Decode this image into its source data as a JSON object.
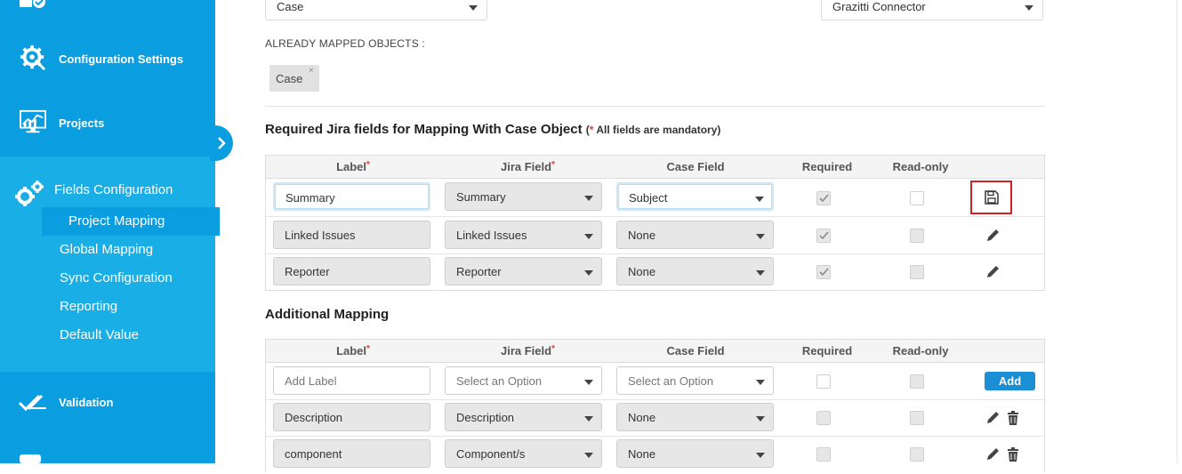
{
  "sidebar": {
    "items": [
      {
        "label": "Configuration Settings",
        "icon": "settings-gear-icon"
      },
      {
        "label": "Projects",
        "icon": "dashboard-monitor-icon"
      },
      {
        "label": "Validation",
        "icon": "double-check-icon"
      }
    ],
    "active_section": {
      "label": "Fields Configuration",
      "icon": "gears-icon",
      "subitems": [
        {
          "label": "Project Mapping",
          "active": true
        },
        {
          "label": "Global Mapping"
        },
        {
          "label": "Sync Configuration"
        },
        {
          "label": "Reporting"
        },
        {
          "label": "Default Value"
        }
      ]
    },
    "toggle_icon": "chevron-right-icon"
  },
  "top_selects": {
    "object": "Case",
    "connector": "Grazitti Connector"
  },
  "mapped": {
    "title": "ALREADY MAPPED OBJECTS :",
    "pills": [
      {
        "label": "Case",
        "remove": "×"
      }
    ]
  },
  "required": {
    "title": "Required Jira fields for Mapping With Case Object",
    "note_star": "*",
    "note_text": " All fields are mandatory)",
    "note_open": "(",
    "headers": {
      "label": "Label",
      "jira": "Jira Field",
      "case": "Case Field",
      "required": "Required",
      "readonly": "Read-only",
      "star": "*"
    },
    "rows": [
      {
        "label": "Summary",
        "jira": "Summary",
        "case": "Subject",
        "required": true,
        "readonly": false,
        "action": "save-icon"
      },
      {
        "label": "Linked Issues",
        "jira": "Linked Issues",
        "case": "None",
        "required": true,
        "readonly": false,
        "action": "pencil-edit-icon"
      },
      {
        "label": "Reporter",
        "jira": "Reporter",
        "case": "None",
        "required": true,
        "readonly": false,
        "action": "pencil-edit-icon"
      }
    ]
  },
  "additional": {
    "title": "Additional Mapping",
    "headers": {
      "label": "Label",
      "jira": "Jira Field",
      "case": "Case Field",
      "required": "Required",
      "readonly": "Read-only",
      "star": "*"
    },
    "new_row": {
      "label_placeholder": "Add Label",
      "jira_placeholder": "Select an Option",
      "case_placeholder": "Select an Option",
      "add_label": "Add"
    },
    "rows": [
      {
        "label": "Description",
        "jira": "Description",
        "case": "None"
      },
      {
        "label": "component",
        "jira": "Component/s",
        "case": "None"
      }
    ]
  },
  "colors": {
    "sidebar": "#0a9ee0",
    "sidebar_active": "#1aaee6",
    "accent_button": "#1a8fd4",
    "highlight_red": "#d91f26",
    "required_star": "#e23b3b"
  }
}
